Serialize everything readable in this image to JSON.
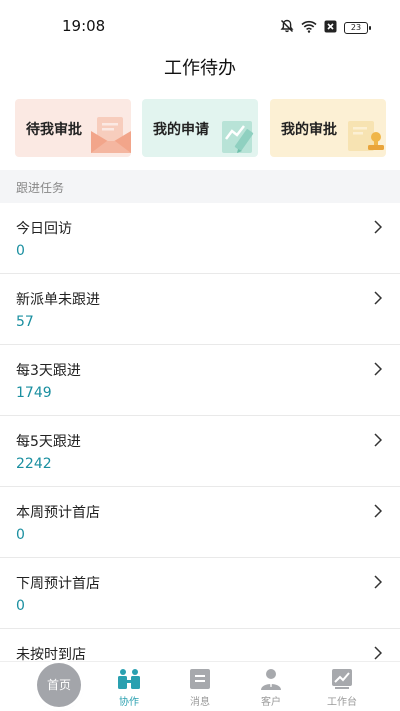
{
  "status": {
    "time": "19:08",
    "battery": "23"
  },
  "header": {
    "title": "工作待办"
  },
  "quick_cards": [
    {
      "label": "待我审批"
    },
    {
      "label": "我的申请"
    },
    {
      "label": "我的审批"
    }
  ],
  "section": {
    "title": "跟进任务"
  },
  "tasks": [
    {
      "name": "今日回访",
      "count": "0"
    },
    {
      "name": "新派单未跟进",
      "count": "57"
    },
    {
      "name": "每3天跟进",
      "count": "1749"
    },
    {
      "name": "每5天跟进",
      "count": "2242"
    },
    {
      "name": "本周预计首店",
      "count": "0"
    },
    {
      "name": "下周预计首店",
      "count": "0"
    },
    {
      "name": "未按时到店",
      "count": ""
    }
  ],
  "tabs": {
    "home": "首页",
    "collab": "协作",
    "messages": "消息",
    "customer": "客户",
    "workbench": "工作台"
  },
  "colors": {
    "accent": "#2aa0b0",
    "count": "#1a8fa0",
    "section_bg": "#f4f5f7"
  }
}
